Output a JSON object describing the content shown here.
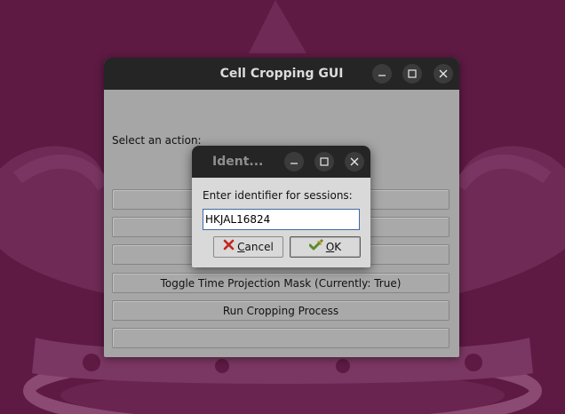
{
  "main_window": {
    "title": "Cell Cropping GUI",
    "prompt": "Select an action:",
    "buttons": [
      {
        "label": ""
      },
      {
        "label": ""
      },
      {
        "label": ""
      },
      {
        "label": "Toggle Time Projection Mask (Currently: True)"
      },
      {
        "label": "Run Cropping Process"
      },
      {
        "label": ""
      }
    ]
  },
  "dialog": {
    "title": "Ident...",
    "label": "Enter identifier for sessions:",
    "input_value": "HKJAL16824",
    "cancel_mnemonic": "C",
    "cancel_rest": "ancel",
    "ok_mnemonic": "O",
    "ok_rest": "K"
  },
  "window_controls": {
    "minimize_icon": "minimize-icon",
    "maximize_icon": "maximize-icon",
    "close_icon": "close-icon"
  },
  "colors": {
    "desktop": "#5e1a43",
    "titlebar": "#252525",
    "window_body": "#a6a6a6",
    "dialog_body": "#d9d9d9",
    "input_border": "#3f6aa5"
  }
}
